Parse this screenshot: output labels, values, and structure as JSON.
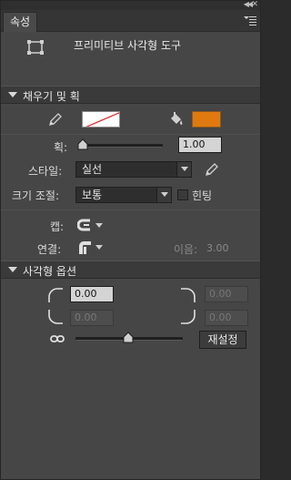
{
  "panel": {
    "tab_label": "속성",
    "tool_name": "프리미티브 사각형 도구"
  },
  "fill_stroke": {
    "section_title": "채우기 및 획",
    "stroke_color": "none",
    "fill_color": "#E07A10",
    "stroke_label": "획:",
    "stroke_value": "1.00",
    "stroke_slider_fraction": 0.0,
    "style_label": "스타일:",
    "style_value": "실선",
    "scale_label": "크기 조절:",
    "scale_value": "보통",
    "hinting_label": "힌팅",
    "hinting_checked": false,
    "cap_label": "캡:",
    "join_label": "연결:",
    "miter_label": "이음:",
    "miter_value": "3.00"
  },
  "rect_options": {
    "section_title": "사각형 옵션",
    "corner_top_left": "0.00",
    "corner_top_right": "0.00",
    "corner_bottom_left": "0.00",
    "corner_bottom_right": "0.00",
    "corner_slider_fraction": 0.5,
    "reset_label": "재설정"
  },
  "icons": {
    "pencil": "pencil-icon",
    "bucket": "paint-bucket-icon",
    "eyedropper": "style-edit-icon",
    "cap": "cap-icon",
    "join": "join-icon",
    "link": "lock-corners-icon",
    "rect_tool": "rectangle-primitive-icon"
  }
}
